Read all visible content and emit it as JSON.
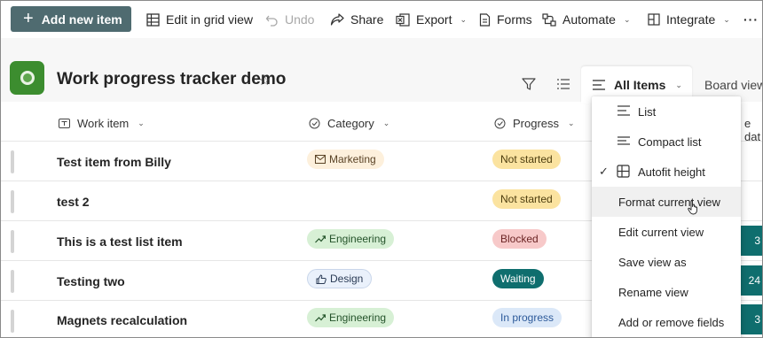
{
  "toolbar": {
    "add_label": "Add new item",
    "grid_label": "Edit in grid view",
    "undo_label": "Undo",
    "share_label": "Share",
    "export_label": "Export",
    "forms_label": "Forms",
    "automate_label": "Automate",
    "integrate_label": "Integrate",
    "more_label": "···"
  },
  "header": {
    "title": "Work progress tracker demo",
    "view_label": "All Items",
    "board_label": "Board view"
  },
  "columns": {
    "work_item": "Work item",
    "category": "Category",
    "progress": "Progress",
    "partial": "e dat"
  },
  "rows": [
    {
      "title": "Test item from Billy",
      "category": "Marketing",
      "category_icon": "mail-icon",
      "progress": "Not started",
      "teal": ""
    },
    {
      "title": "test 2",
      "category": "",
      "category_icon": "",
      "progress": "Not started",
      "teal": ""
    },
    {
      "title": "This is a test list item",
      "category": "Engineering",
      "category_icon": "trend-icon",
      "progress": "Blocked",
      "teal": "3"
    },
    {
      "title": "Testing two",
      "category": "Design",
      "category_icon": "thumbs-up-icon",
      "progress": "Waiting",
      "teal": "24"
    },
    {
      "title": "Magnets recalculation",
      "category": "Engineering",
      "category_icon": "trend-icon",
      "progress": "In progress",
      "teal": "3"
    }
  ],
  "menu": {
    "list": "List",
    "compact_list": "Compact list",
    "autofit": "Autofit height",
    "format_view": "Format current view",
    "edit_view": "Edit current view",
    "save_view": "Save view as",
    "rename_view": "Rename view",
    "add_remove": "Add or remove fields"
  },
  "colors": {
    "primary_button": "#4f6b70",
    "marketing_bg": "#fdf0dc",
    "engineering_bg": "#d7f0d5",
    "design_bg": "#eaf1fb",
    "not_started_bg": "#fbe3a0",
    "blocked_bg": "#f7c9c9",
    "waiting_bg": "#0f6e6e",
    "in_progress_bg": "#dbe8f8"
  }
}
